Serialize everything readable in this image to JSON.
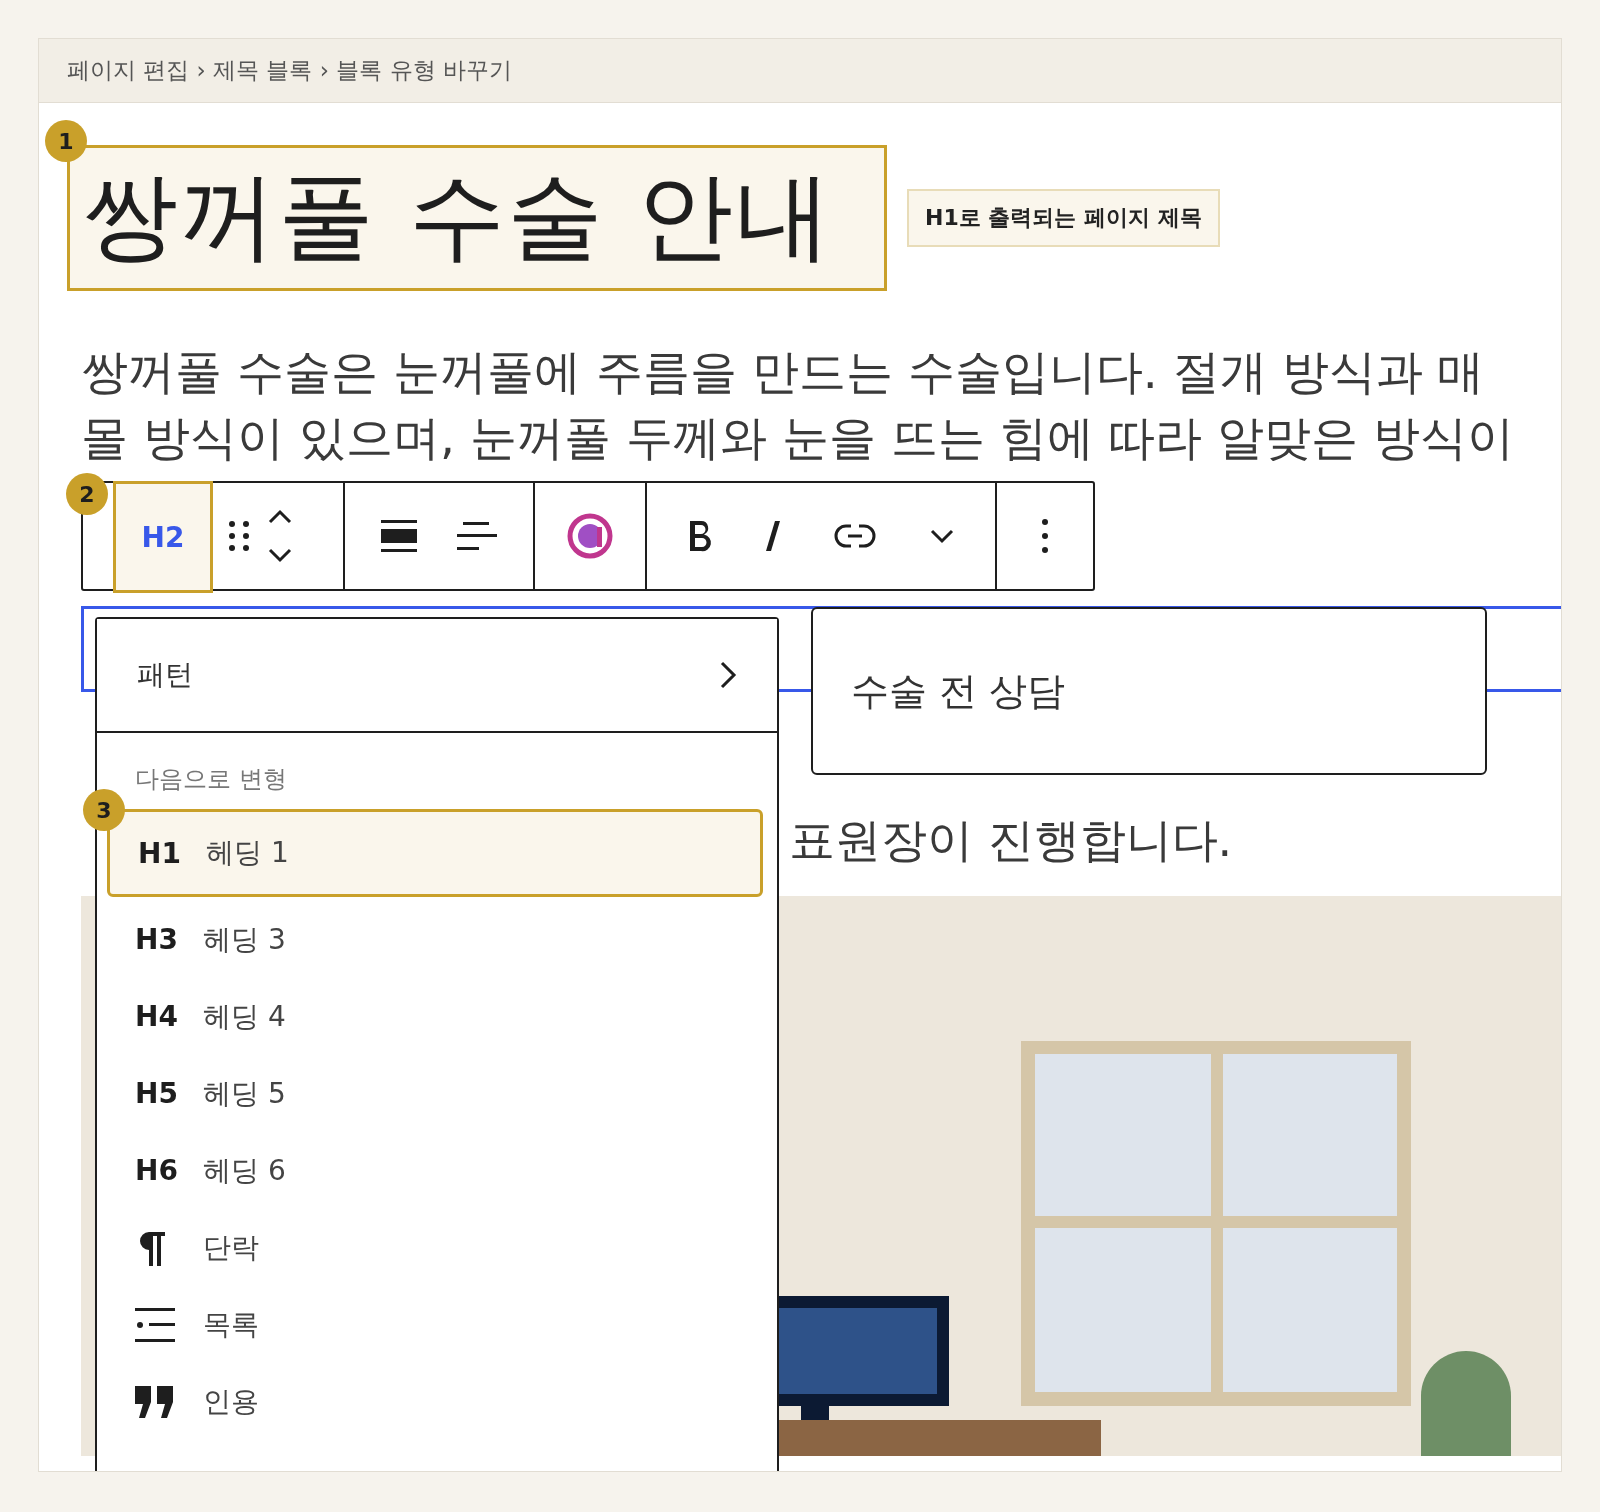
{
  "breadcrumb": "페이지 편집 › 제목 블록 › 블록 유형 바꾸기",
  "title": {
    "text": "쌍꺼풀 수술 안내",
    "callout": "1",
    "note": "H1로 출력되는 페이지 제목"
  },
  "paragraph": {
    "lines": [
      "쌍꺼풀 수술은 눈꺼풀에 주름을 만드는 수술입니다. 절개 방식과 매",
      "몰 방식이 있으며, 눈꺼풀 두께와 눈을 뜨는 힘에 따라 알맞은 방식이"
    ]
  },
  "toolbar": {
    "block_type": "H2",
    "callout": "2",
    "highlighted": true
  },
  "dropdown": {
    "pattern_item": "패턴",
    "section_label": "다음으로 변형",
    "callout": "3",
    "items": [
      {
        "kind": "heading",
        "tag": "H1",
        "label": "헤딩 1",
        "selected": true
      },
      {
        "kind": "heading",
        "tag": "H3",
        "label": "헤딩 3",
        "selected": false
      },
      {
        "kind": "heading",
        "tag": "H4",
        "label": "헤딩 4",
        "selected": false
      },
      {
        "kind": "heading",
        "tag": "H5",
        "label": "헤딩 5",
        "selected": false
      },
      {
        "kind": "heading",
        "tag": "H6",
        "label": "헤딩 6",
        "selected": false
      },
      {
        "kind": "paragraph",
        "label": "단락",
        "selected": false
      },
      {
        "kind": "list",
        "label": "목록",
        "selected": false
      },
      {
        "kind": "quote",
        "label": "인용",
        "selected": false
      }
    ]
  },
  "preview": {
    "text": "수술 전 상담"
  },
  "paragraph_2": {
    "visible_text": "표원장이 진행합니다."
  }
}
